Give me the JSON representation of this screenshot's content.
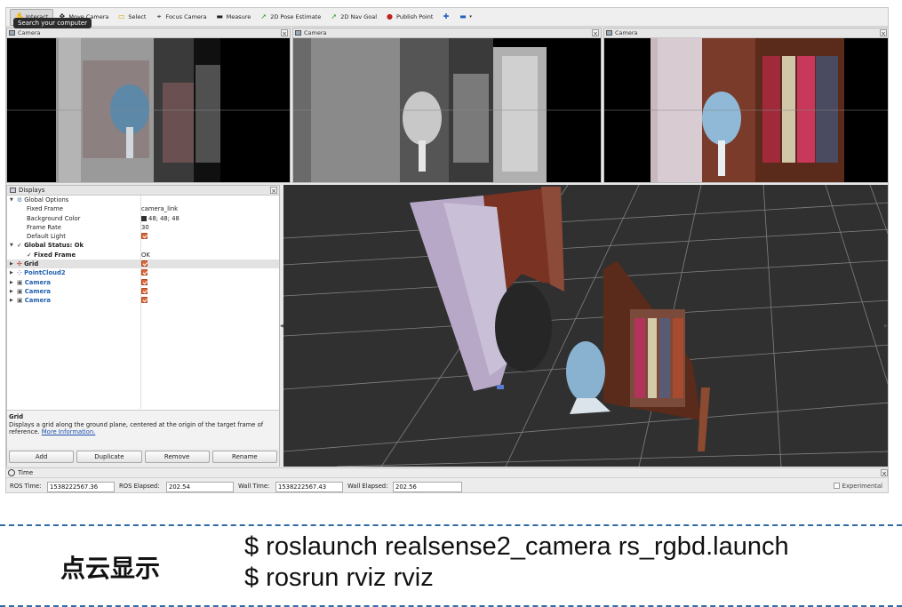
{
  "toolbar": {
    "items": [
      {
        "label": "Interact",
        "icon": "hand-icon",
        "active": true
      },
      {
        "label": "Move Camera",
        "icon": "move-icon"
      },
      {
        "label": "Select",
        "icon": "select-icon"
      },
      {
        "label": "Focus Camera",
        "icon": "crosshair-icon"
      },
      {
        "label": "Measure",
        "icon": "ruler-icon"
      },
      {
        "label": "2D Pose Estimate",
        "icon": "green-arrow-icon"
      },
      {
        "label": "2D Nav Goal",
        "icon": "green-arrow-icon"
      },
      {
        "label": "Publish Point",
        "icon": "pin-icon"
      }
    ],
    "tooltip": "Search your computer"
  },
  "cameras": [
    {
      "title": "Camera"
    },
    {
      "title": "Camera"
    },
    {
      "title": "Camera"
    }
  ],
  "displays": {
    "title": "Displays",
    "rows": [
      {
        "label": "Global Options",
        "value": ""
      },
      {
        "label": "Fixed Frame",
        "value": "camera_link"
      },
      {
        "label": "Background Color",
        "value": "48; 48; 48"
      },
      {
        "label": "Frame Rate",
        "value": "30"
      },
      {
        "label": "Default Light",
        "value": ""
      },
      {
        "label": "Global Status: Ok",
        "value": ""
      },
      {
        "label": "Fixed Frame",
        "value": "OK"
      },
      {
        "label": "Grid",
        "value": ""
      },
      {
        "label": "PointCloud2",
        "value": ""
      },
      {
        "label": "Camera",
        "value": ""
      },
      {
        "label": "Camera",
        "value": ""
      },
      {
        "label": "Camera",
        "value": ""
      }
    ],
    "desc_title": "Grid",
    "desc_text": "Displays a grid along the ground plane, centered at the origin of the target frame of reference.",
    "desc_link": "More Information.",
    "buttons": {
      "add": "Add",
      "duplicate": "Duplicate",
      "remove": "Remove",
      "rename": "Rename"
    }
  },
  "time": {
    "title": "Time",
    "ros_time_label": "ROS Time:",
    "ros_time": "1538222567.36",
    "ros_elapsed_label": "ROS Elapsed:",
    "ros_elapsed": "202.54",
    "wall_time_label": "Wall Time:",
    "wall_time": "1538222567.43",
    "wall_elapsed_label": "Wall Elapsed:",
    "wall_elapsed": "202.56",
    "experimental": "Experimental"
  },
  "caption": {
    "label": "点云显示",
    "cmd1": "$ roslaunch realsense2_camera rs_rgbd.launch",
    "cmd2": "$ rosrun rviz rviz"
  },
  "colors": {
    "background": "#303030",
    "accent": "#2f6aa3"
  }
}
